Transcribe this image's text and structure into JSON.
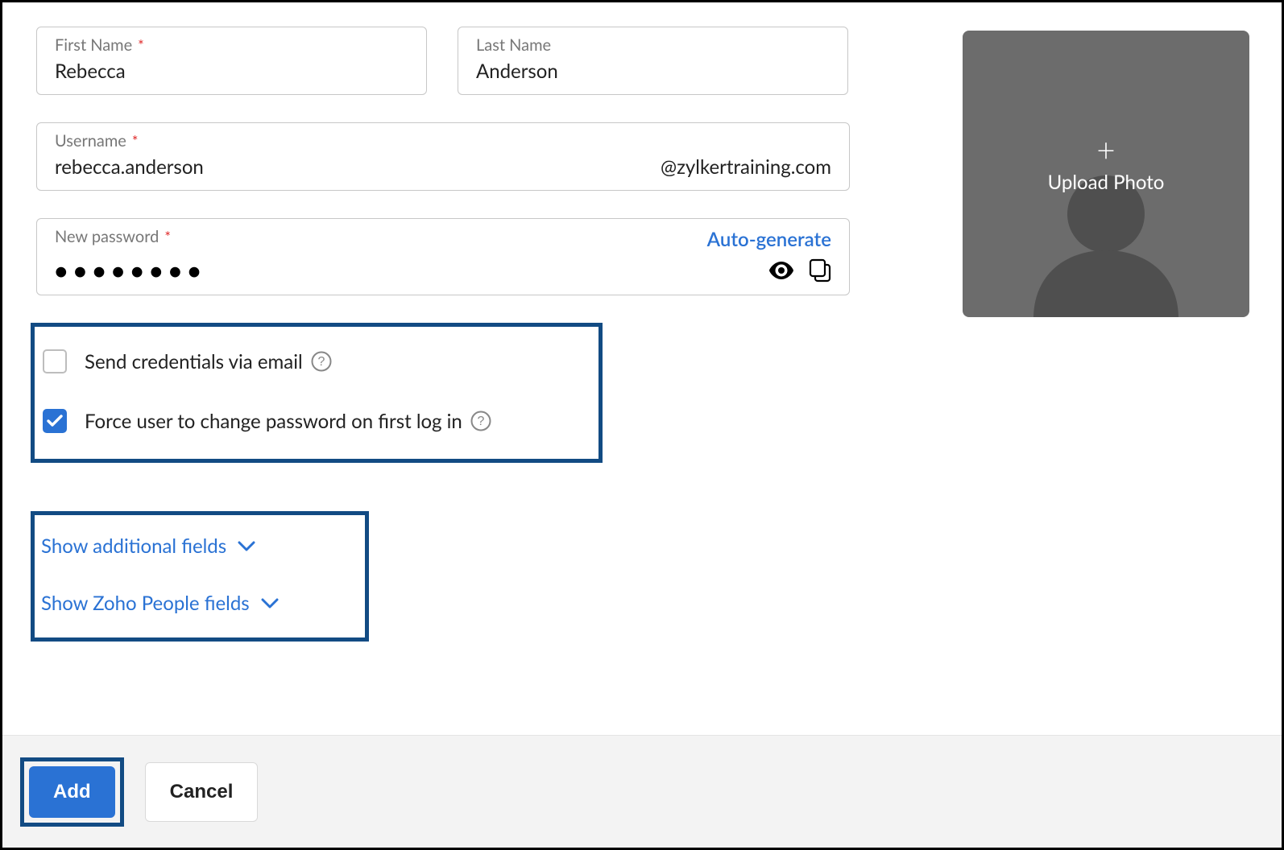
{
  "fields": {
    "first_name": {
      "label": "First Name",
      "value": "Rebecca",
      "required": true
    },
    "last_name": {
      "label": "Last Name",
      "value": "Anderson",
      "required": false
    },
    "username": {
      "label": "Username",
      "value": "rebecca.anderson",
      "domain_suffix": "@zylkertraining.com",
      "required": true
    },
    "password": {
      "label": "New password",
      "mask": "●●●●●●●●",
      "required": true,
      "autogen_label": "Auto-generate"
    }
  },
  "options": {
    "send_email": {
      "label": "Send credentials via email",
      "checked": false
    },
    "force_change": {
      "label": "Force user to change password on first log in",
      "checked": true
    }
  },
  "links": {
    "additional": "Show additional fields",
    "zoho_people": "Show Zoho People fields"
  },
  "photo": {
    "upload_label": "Upload Photo",
    "plus": "+"
  },
  "footer": {
    "add": "Add",
    "cancel": "Cancel"
  }
}
